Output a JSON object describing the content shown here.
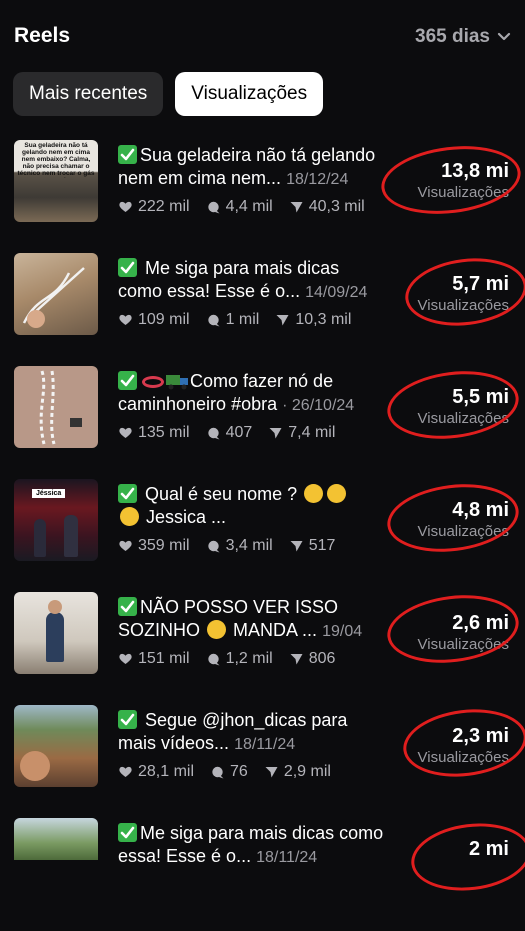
{
  "header": {
    "title": "Reels",
    "range_label": "365 dias"
  },
  "tabs": [
    {
      "label": "Mais recentes"
    },
    {
      "label": "Visualizações"
    }
  ],
  "items": [
    {
      "text": "Sua geladeira não tá gelando nem em cima nem...",
      "date": "18/12/24",
      "likes": "222 mil",
      "comments": "4,4 mil",
      "shares": "40,3 mil",
      "views": "13,8 mi",
      "views_label": "Visualizações",
      "thumb_text": "Sua geladeira não tá gelando nem em cima nem embaixo? Calma, não precisa chamar o técnico nem trocar o gás agora!"
    },
    {
      "text": "Me siga para mais dicas como essa! Esse é o...",
      "date": "14/09/24",
      "likes": "109 mil",
      "comments": "1 mil",
      "shares": "10,3 mil",
      "views": "5,7 mi",
      "views_label": "Visualizações"
    },
    {
      "text": "Como fazer nó de caminhoneiro #obra",
      "date": "· 26/10/24",
      "likes": "135 mil",
      "comments": "407",
      "shares": "7,4 mil",
      "views": "5,5 mi",
      "views_label": "Visualizações"
    },
    {
      "text_a": "Qual é seu nome ?",
      "text_b": "Jessica ...",
      "likes": "359 mil",
      "comments": "3,4 mil",
      "shares": "517",
      "views": "4,8 mi",
      "views_label": "Visualizações",
      "thumb_text": "Jéssica"
    },
    {
      "text_a": "NÃO POSSO VER ISSO SOZINHO",
      "text_b": "MANDA ...",
      "date": "19/04",
      "likes": "151 mil",
      "comments": "1,2 mil",
      "shares": "806",
      "views": "2,6 mi",
      "views_label": "Visualizações"
    },
    {
      "text": "Segue @jhon_dicas para mais vídeos...",
      "date": "18/11/24",
      "likes": "28,1 mil",
      "comments": "76",
      "shares": "2,9 mil",
      "views": "2,3 mi",
      "views_label": "Visualizações"
    },
    {
      "text": "Me siga para mais dicas como essa! Esse é o...",
      "date": "18/11/24",
      "views": "2 mi"
    }
  ],
  "colors": {
    "background": "#0c0c0e",
    "annotation_red": "#e01e1e",
    "check_green": "#36b24a",
    "muted_text": "#9a9aa0"
  },
  "icons": {
    "like": "heart-icon",
    "comment": "comment-bubble-icon",
    "share": "send-icon",
    "range": "chevron-down-icon",
    "check": "check-mark-icon"
  }
}
